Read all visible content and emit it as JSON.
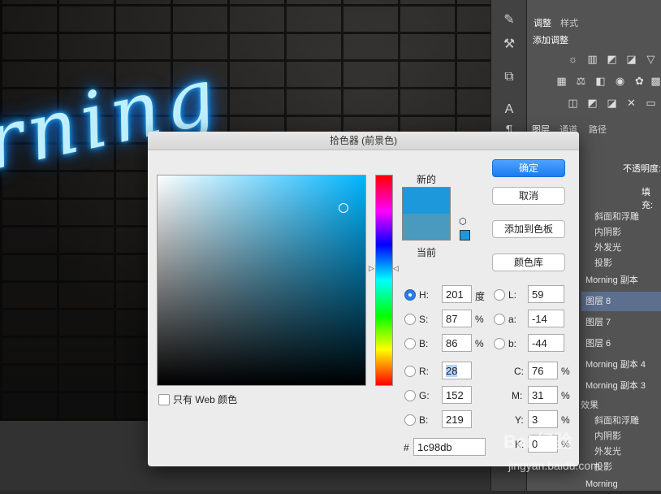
{
  "canvas": {
    "neon_text": "rning"
  },
  "right_panel": {
    "tabs_top": [
      "调整",
      "样式"
    ],
    "adjust_title": "添加调整",
    "tabs_layers": [
      "图层",
      "通道",
      "路径"
    ],
    "opacity_label": "不透明度:",
    "fill_label": "填充:",
    "layer_effects_1": [
      "斜面和浮雕",
      "内阴影",
      "外发光",
      "投影"
    ],
    "layers": [
      "Morning 副本",
      "图层 8",
      "图层 7",
      "图层 6",
      "Morning 副本 4",
      "Morning 副本 3"
    ],
    "effects_label": "效果",
    "layer_effects_2": [
      "斜面和浮雕",
      "内阴影",
      "外发光",
      "投影"
    ],
    "last_layer": "Morning"
  },
  "dialog": {
    "title": "拾色器 (前景色)",
    "new_label": "新的",
    "current_label": "当前",
    "buttons": {
      "ok": "确定",
      "cancel": "取消",
      "add_swatch": "添加到色板",
      "color_libraries": "颜色库"
    },
    "web_only": "只有 Web 颜色",
    "fields": {
      "H": {
        "label": "H:",
        "value": "201",
        "unit": "度"
      },
      "S": {
        "label": "S:",
        "value": "87",
        "unit": "%"
      },
      "Bv": {
        "label": "B:",
        "value": "86",
        "unit": "%"
      },
      "R": {
        "label": "R:",
        "value": "28"
      },
      "G": {
        "label": "G:",
        "value": "152"
      },
      "Bl": {
        "label": "B:",
        "value": "219"
      },
      "L": {
        "label": "L:",
        "value": "59"
      },
      "a": {
        "label": "a:",
        "value": "-14"
      },
      "b": {
        "label": "b:",
        "value": "-44"
      },
      "C": {
        "label": "C:",
        "value": "76",
        "unit": "%"
      },
      "M": {
        "label": "M:",
        "value": "31",
        "unit": "%"
      },
      "Y": {
        "label": "Y:",
        "value": "3",
        "unit": "%"
      },
      "K": {
        "label": "K:",
        "value": "0",
        "unit": "%"
      }
    },
    "hex_label": "#",
    "hex_value": "1c98db",
    "colors": {
      "new": "#1c98db",
      "current": "#4a9abf"
    }
  },
  "watermark": {
    "line1": "Bai 经验",
    "line2": "jingyan.baidu.com"
  }
}
